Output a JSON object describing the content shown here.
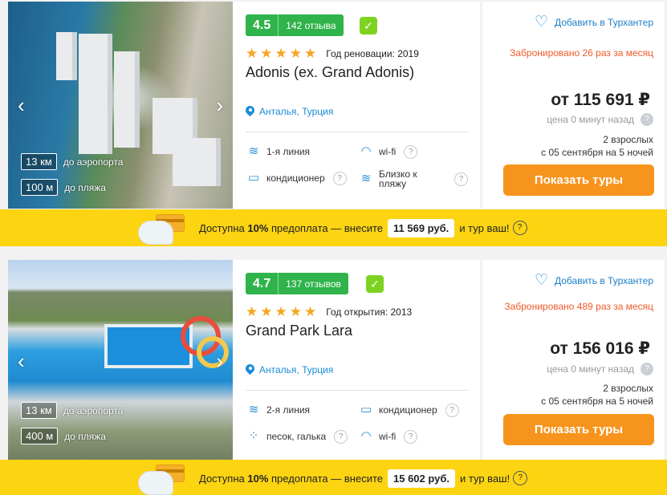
{
  "hotels": [
    {
      "distances": [
        {
          "value": "13 км",
          "label": "до аэропорта"
        },
        {
          "value": "100 м",
          "label": "до пляжа"
        }
      ],
      "rating": "4.5",
      "reviews": "142 отзыва",
      "year_text": "Год реновации: 2019",
      "name": "Adonis (ex. Grand Adonis)",
      "location": "Анталья, Турция",
      "features": [
        {
          "icon": "beach-line-icon",
          "label": "1-я линия"
        },
        {
          "icon": "wifi-icon",
          "label": "wi-fi"
        },
        {
          "icon": "air-conditioner-icon",
          "label": "кондиционер"
        },
        {
          "icon": "beach-near-icon",
          "label": "Близко к пляжу"
        }
      ],
      "favorite_label": "Добавить в Турхантер",
      "booked": "Забронировано 26 раз за месяц",
      "price": "от 115 691 ₽",
      "price_age": "цена 0 минут назад",
      "pax_line1": "2 взрослых",
      "pax_line2": "с 05 сентября на 5 ночей",
      "button": "Показать туры",
      "banner": {
        "before": "Доступна",
        "percent": "10%",
        "middle": "предоплата — внесите",
        "amount": "11 569 руб.",
        "after": "и тур ваш!"
      }
    },
    {
      "distances": [
        {
          "value": "13 км",
          "label": "до аэропорта"
        },
        {
          "value": "400 м",
          "label": "до пляжа"
        }
      ],
      "rating": "4.7",
      "reviews": "137 отзывов",
      "year_text": "Год открытия: 2013",
      "name": "Grand Park Lara",
      "location": "Анталья, Турция",
      "features": [
        {
          "icon": "beach-line-icon",
          "label": "2-я линия"
        },
        {
          "icon": "air-conditioner-icon",
          "label": "кондиционер"
        },
        {
          "icon": "sand-pebble-icon",
          "label": "песок, галька"
        },
        {
          "icon": "wifi-icon",
          "label": "wi-fi"
        }
      ],
      "favorite_label": "Добавить в Турхантер",
      "booked": "Забронировано 489 раз за месяц",
      "price": "от 156 016 ₽",
      "price_age": "цена 0 минут назад",
      "pax_line1": "2 взрослых",
      "pax_line2": "с 05 сентября на 5 ночей",
      "button": "Показать туры",
      "banner": {
        "before": "Доступна",
        "percent": "10%",
        "middle": "предоплата — внесите",
        "amount": "15 602 руб.",
        "after": "и тур ваш!"
      }
    }
  ],
  "colors": {
    "rating_green": "#2fb34a",
    "check_green": "#7ed321",
    "accent_blue": "#1a8cd8",
    "booked_orange": "#f05a28",
    "button_orange": "#f7941d",
    "banner_yellow": "#fcd412"
  }
}
